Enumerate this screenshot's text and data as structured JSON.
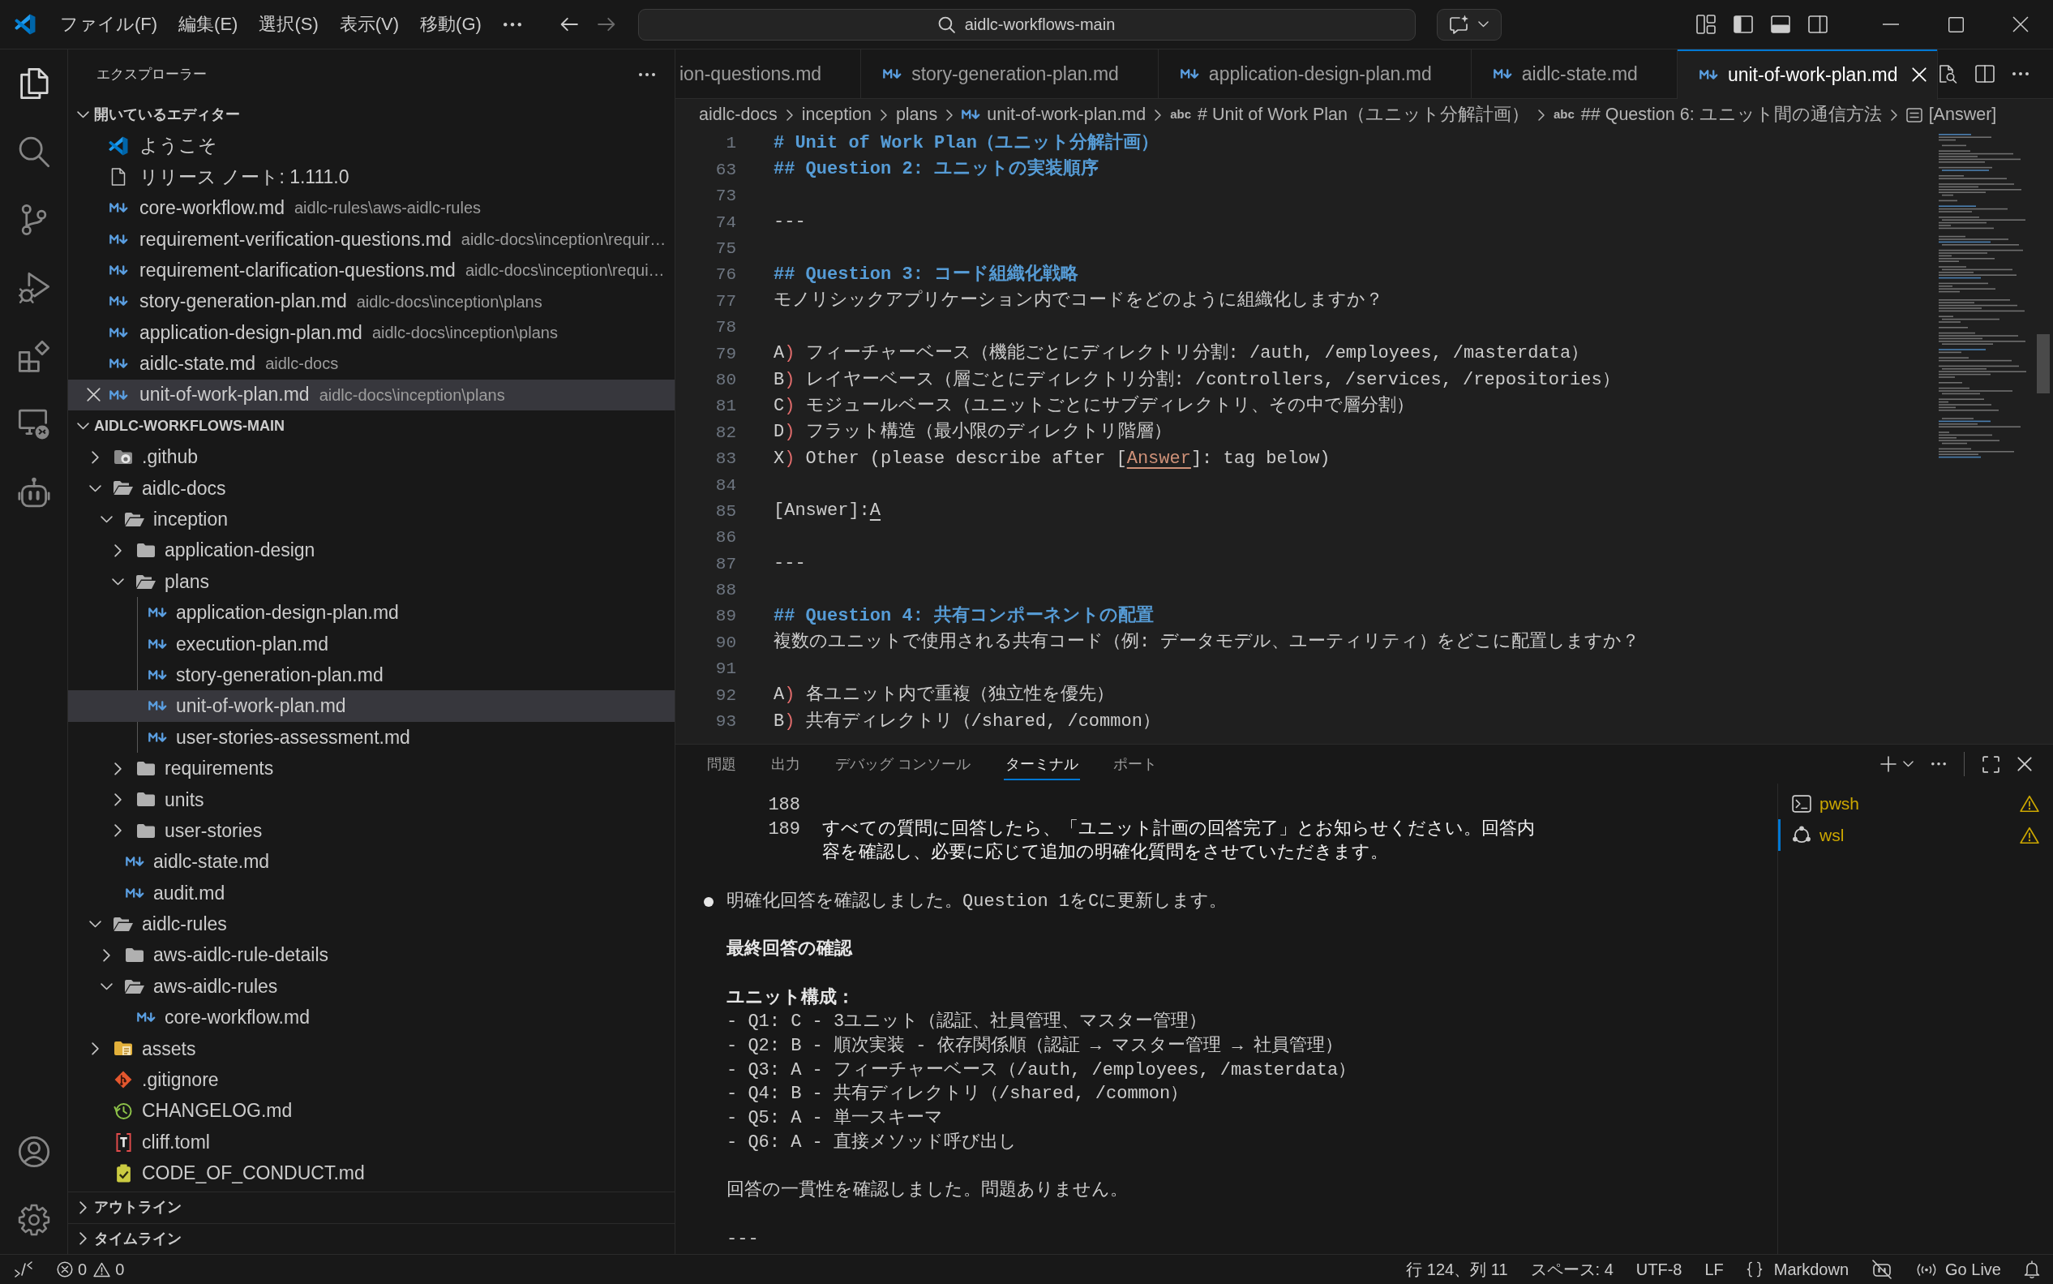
{
  "title_bar": {
    "menus": [
      "ファイル(F)",
      "編集(E)",
      "選択(S)",
      "表示(V)",
      "移動(G)"
    ],
    "back_disabled": false,
    "forward_disabled": true,
    "command_center": "aidlc-workflows-main",
    "layout_toggles": [
      {
        "on": true
      },
      {
        "on": true
      },
      {
        "on": false
      }
    ]
  },
  "activity_bar": {
    "items": [
      {
        "selected": true
      },
      {
        "selected": false
      },
      {
        "selected": false
      },
      {
        "selected": false
      },
      {
        "selected": false
      },
      {
        "selected": false
      },
      {
        "selected": false
      }
    ]
  },
  "sidebar": {
    "title": "エクスプローラー",
    "open_editors": {
      "title": "開いているエディター",
      "expanded": true,
      "items": [
        {
          "kind": "welcome",
          "name": "ようこそ",
          "selected": false
        },
        {
          "kind": "notes",
          "name": "リリース ノート: 1.111.0",
          "selected": false
        },
        {
          "kind": "markdown",
          "name": "core-workflow.md",
          "path": "aidlc-rules\\aws-aidlc-rules",
          "selected": false
        },
        {
          "kind": "markdown",
          "name": "requirement-verification-questions.md",
          "path": "aidlc-docs\\inception\\requir…",
          "selected": false
        },
        {
          "kind": "markdown",
          "name": "requirement-clarification-questions.md",
          "path": "aidlc-docs\\inception\\requi…",
          "selected": false
        },
        {
          "kind": "markdown",
          "name": "story-generation-plan.md",
          "path": "aidlc-docs\\inception\\plans",
          "selected": false
        },
        {
          "kind": "markdown",
          "name": "application-design-plan.md",
          "path": "aidlc-docs\\inception\\plans",
          "selected": false
        },
        {
          "kind": "markdown",
          "name": "aidlc-state.md",
          "path": "aidlc-docs",
          "selected": false
        },
        {
          "kind": "markdown",
          "name": "unit-of-work-plan.md",
          "path": "aidlc-docs\\inception\\plans",
          "selected": true
        }
      ]
    },
    "folder": {
      "title": "AIDLC-WORKFLOWS-MAIN",
      "expanded": true,
      "tree": [
        {
          "kind": "github",
          "name": ".github",
          "expanded": false,
          "selected": false
        },
        {
          "kind": "folder",
          "name": "aidlc-docs",
          "expanded": true,
          "selected": false,
          "children": [
            {
              "kind": "folder",
              "name": "inception",
              "expanded": true,
              "selected": false,
              "children": [
                {
                  "kind": "folder",
                  "name": "application-design",
                  "expanded": false,
                  "selected": false
                },
                {
                  "kind": "folder",
                  "name": "plans",
                  "expanded": true,
                  "selected": false,
                  "children": [
                    {
                      "kind": "markdown",
                      "name": "application-design-plan.md",
                      "selected": false
                    },
                    {
                      "kind": "markdown",
                      "name": "execution-plan.md",
                      "selected": false
                    },
                    {
                      "kind": "markdown",
                      "name": "story-generation-plan.md",
                      "selected": false
                    },
                    {
                      "kind": "markdown",
                      "name": "unit-of-work-plan.md",
                      "selected": true
                    },
                    {
                      "kind": "markdown",
                      "name": "user-stories-assessment.md",
                      "selected": false
                    }
                  ]
                },
                {
                  "kind": "folder",
                  "name": "requirements",
                  "expanded": false,
                  "selected": false
                },
                {
                  "kind": "folder",
                  "name": "units",
                  "expanded": false,
                  "selected": false
                },
                {
                  "kind": "folder",
                  "name": "user-stories",
                  "expanded": false,
                  "selected": false
                }
              ]
            },
            {
              "kind": "markdown",
              "name": "aidlc-state.md",
              "selected": false
            },
            {
              "kind": "markdown",
              "name": "audit.md",
              "selected": false
            }
          ]
        },
        {
          "kind": "folder",
          "name": "aidlc-rules",
          "expanded": true,
          "selected": false,
          "children": [
            {
              "kind": "folder",
              "name": "aws-aidlc-rule-details",
              "expanded": false,
              "selected": false
            },
            {
              "kind": "folder",
              "name": "aws-aidlc-rules",
              "expanded": true,
              "selected": false,
              "children": [
                {
                  "kind": "markdown",
                  "name": "core-workflow.md",
                  "selected": false
                }
              ]
            }
          ]
        },
        {
          "kind": "assets",
          "name": "assets",
          "expanded": false,
          "selected": false
        },
        {
          "kind": "gitignore",
          "name": ".gitignore",
          "selected": false
        },
        {
          "kind": "changelog",
          "name": "CHANGELOG.md",
          "selected": false
        },
        {
          "kind": "toml",
          "name": "cliff.toml",
          "selected": false
        },
        {
          "kind": "conduct",
          "name": "CODE_OF_CONDUCT.md",
          "selected": false
        }
      ]
    },
    "sections": [
      {
        "title": "アウトライン",
        "expanded": false
      },
      {
        "title": "タイムライン",
        "expanded": false
      }
    ]
  },
  "editor": {
    "tabs": [
      {
        "label": "ion-questions.md",
        "icon": false,
        "selected": false
      },
      {
        "label": "story-generation-plan.md",
        "icon": true,
        "selected": false
      },
      {
        "label": "application-design-plan.md",
        "icon": true,
        "selected": false
      },
      {
        "label": "aidlc-state.md",
        "icon": true,
        "selected": false
      },
      {
        "label": "unit-of-work-plan.md",
        "icon": true,
        "selected": true
      }
    ],
    "breadcrumbs": [
      {
        "kind": "folder",
        "text": "aidlc-docs"
      },
      {
        "kind": "folder",
        "text": "inception"
      },
      {
        "kind": "folder",
        "text": "plans"
      },
      {
        "kind": "markdown",
        "text": "unit-of-work-plan.md"
      },
      {
        "kind": "heading",
        "symbol": "abc",
        "text": "# Unit of Work Plan（ユニット分解計画）"
      },
      {
        "kind": "heading",
        "symbol": "abc",
        "text": "## Question 6: ユニット間の通信方法"
      },
      {
        "kind": "field",
        "text": "[Answer]"
      }
    ],
    "lines": [
      {
        "number": "1",
        "segments": [
          {
            "kind": "heading",
            "text": "# Unit of Work Plan（ユニット分解計画）"
          }
        ]
      },
      {
        "number": "63",
        "segments": [
          {
            "kind": "heading",
            "text": "## Question 2: ユニットの実装順序"
          }
        ]
      },
      {
        "number": "73"
      },
      {
        "number": "74",
        "segments": [
          {
            "kind": "plain",
            "text": "---"
          }
        ]
      },
      {
        "number": "75"
      },
      {
        "number": "76",
        "segments": [
          {
            "kind": "heading",
            "text": "## Question 3: コード組織化戦略"
          }
        ]
      },
      {
        "number": "77",
        "segments": [
          {
            "kind": "plain",
            "text": "モノリシックアプリケーション内でコードをどのように組織化しますか？"
          }
        ]
      },
      {
        "number": "78"
      },
      {
        "number": "79",
        "segments": [
          {
            "kind": "plain",
            "text": "A"
          },
          {
            "kind": "marker",
            "text": ")"
          },
          {
            "kind": "plain",
            "text": " フィーチャーベース（機能ごとにディレクトリ分割: /auth, /employees, /masterdata）"
          }
        ]
      },
      {
        "number": "80",
        "segments": [
          {
            "kind": "plain",
            "text": "B"
          },
          {
            "kind": "marker",
            "text": ")"
          },
          {
            "kind": "plain",
            "text": " レイヤーベース（層ごとにディレクトリ分割: /controllers, /services, /repositories）"
          }
        ]
      },
      {
        "number": "81",
        "segments": [
          {
            "kind": "plain",
            "text": "C"
          },
          {
            "kind": "marker",
            "text": ")"
          },
          {
            "kind": "plain",
            "text": " モジュールベース（ユニットごとにサブディレクトリ、その中で層分割）"
          }
        ]
      },
      {
        "number": "82",
        "segments": [
          {
            "kind": "plain",
            "text": "D"
          },
          {
            "kind": "marker",
            "text": ")"
          },
          {
            "kind": "plain",
            "text": " フラット構造（最小限のディレクトリ階層）"
          }
        ]
      },
      {
        "number": "83",
        "segments": [
          {
            "kind": "plain",
            "text": "X"
          },
          {
            "kind": "marker",
            "text": ")"
          },
          {
            "kind": "plain",
            "text": " Other (please describe after ["
          },
          {
            "kind": "link",
            "text": "Answer"
          },
          {
            "kind": "plain",
            "text": "]: tag below)"
          }
        ]
      },
      {
        "number": "84"
      },
      {
        "number": "85",
        "segments": [
          {
            "kind": "plain",
            "text": "[Answer]:"
          },
          {
            "kind": "url",
            "text": "A"
          }
        ]
      },
      {
        "number": "86"
      },
      {
        "number": "87",
        "segments": [
          {
            "kind": "plain",
            "text": "---"
          }
        ]
      },
      {
        "number": "88"
      },
      {
        "number": "89",
        "segments": [
          {
            "kind": "heading",
            "text": "## Question 4: 共有コンポーネントの配置"
          }
        ]
      },
      {
        "number": "90",
        "segments": [
          {
            "kind": "plain",
            "text": "複数のユニットで使用される共有コード（例: データモデル、ユーティリティ）をどこに配置しますか？"
          }
        ]
      },
      {
        "number": "91"
      },
      {
        "number": "92",
        "segments": [
          {
            "kind": "plain",
            "text": "A"
          },
          {
            "kind": "marker",
            "text": ")"
          },
          {
            "kind": "plain",
            "text": " 各ユニット内で重複（独立性を優先）"
          }
        ]
      },
      {
        "number": "93",
        "segments": [
          {
            "kind": "plain",
            "text": "B"
          },
          {
            "kind": "marker",
            "text": ")"
          },
          {
            "kind": "plain",
            "text": " 共有ディレクトリ（/shared, /common）"
          }
        ]
      }
    ]
  },
  "panel": {
    "tabs": [
      {
        "label": "問題",
        "selected": false
      },
      {
        "label": "出力",
        "selected": false
      },
      {
        "label": "デバッグ コンソール",
        "selected": false
      },
      {
        "label": "ターミナル",
        "selected": true
      },
      {
        "label": "ポート",
        "selected": false
      }
    ],
    "terminal": {
      "numbered_lines": [
        {
          "number": "188"
        },
        {
          "number": "189",
          "text": "すべての質問に回答したら、「ユニット計画の回答完了」とお知らせください。回答内容を確認し、必要に応じて追加の明確化質問をさせていただきます。"
        }
      ],
      "blocks": [
        {
          "kind": "bullet",
          "text": "明確化回答を確認しました。Question 1をCに更新します。"
        },
        {
          "kind": "heading",
          "text": "最終回答の確認"
        },
        {
          "kind": "list",
          "title": "ユニット構成：",
          "items": [
            "- Q1: C - 3ユニット（認証、社員管理、マスター管理）",
            "- Q2: B - 順次実装 - 依存関係順（認証 → マスター管理 → 社員管理）",
            "- Q3: A - フィーチャーベース（/auth, /employees, /masterdata）",
            "- Q4: B - 共有ディレクトリ（/shared, /common）",
            "- Q5: A - 単一スキーマ",
            "- Q6: A - 直接メソッド呼び出し"
          ]
        },
        {
          "kind": "text",
          "text": "回答の一貫性を確認しました。問題ありません。"
        },
        {
          "kind": "text",
          "text": "---"
        }
      ]
    },
    "terminals": [
      {
        "kind": "shell",
        "name": "pwsh",
        "selected": false,
        "warning": true
      },
      {
        "kind": "linux",
        "name": "wsl",
        "selected": true,
        "warning": true
      }
    ]
  },
  "status_bar": {
    "errors": "0",
    "warnings": "0",
    "items": [
      {
        "kind": "text",
        "text": "行 124、列 11"
      },
      {
        "kind": "text",
        "text": "スペース: 4"
      },
      {
        "kind": "text",
        "text": "UTF-8"
      },
      {
        "kind": "text",
        "text": "LF"
      },
      {
        "kind": "language",
        "text": "Markdown"
      },
      {
        "kind": "copilot"
      },
      {
        "kind": "live",
        "text": "Go Live"
      },
      {
        "kind": "notifications"
      }
    ]
  }
}
